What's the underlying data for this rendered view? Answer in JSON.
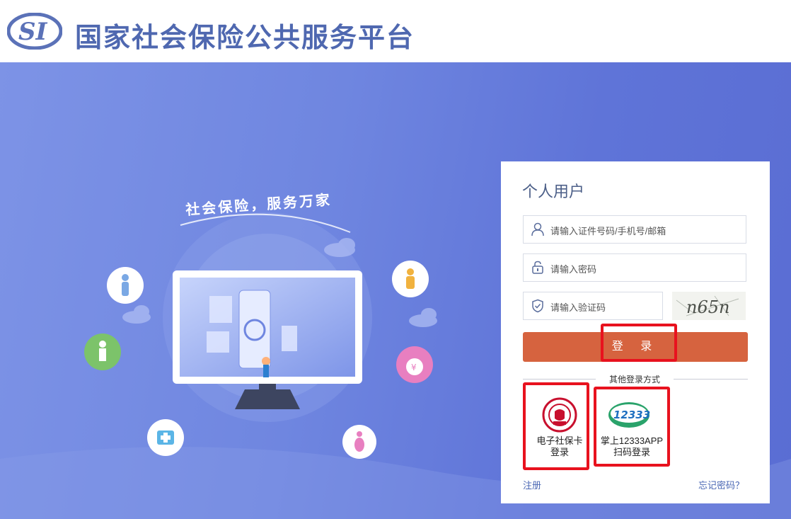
{
  "header": {
    "title": "国家社会保险公共服务平台",
    "logo_text": "SI"
  },
  "hero": {
    "slogan": "社会保险，服务万家",
    "colors": {
      "background": "#6f86e0",
      "monitor_frame": "#ffffff",
      "monitor_stand": "#3d4560"
    }
  },
  "login": {
    "title": "个人用户",
    "id_field": {
      "placeholder": "请输入证件号码/手机号/邮箱",
      "icon": "user-icon"
    },
    "password_field": {
      "placeholder": "请输入密码",
      "icon": "lock-icon"
    },
    "captcha_field": {
      "placeholder": "请输入验证码",
      "icon": "shield-icon"
    },
    "captcha_text": "n65n",
    "login_label": "登 录",
    "other_methods_label": "其他登录方式",
    "methods": [
      {
        "label_line1": "电子社保卡",
        "label_line2": "登录",
        "icon": "social-security-card-icon"
      },
      {
        "label_line1": "掌上12333APP",
        "label_line2": "扫码登录",
        "icon": "app-12333-icon",
        "logo_text": "12333"
      }
    ],
    "register_label": "注册",
    "forgot_label": "忘记密码？",
    "colors": {
      "login_button": "#d6633f",
      "highlight": "#e8121e",
      "link": "#4a67b4"
    }
  }
}
